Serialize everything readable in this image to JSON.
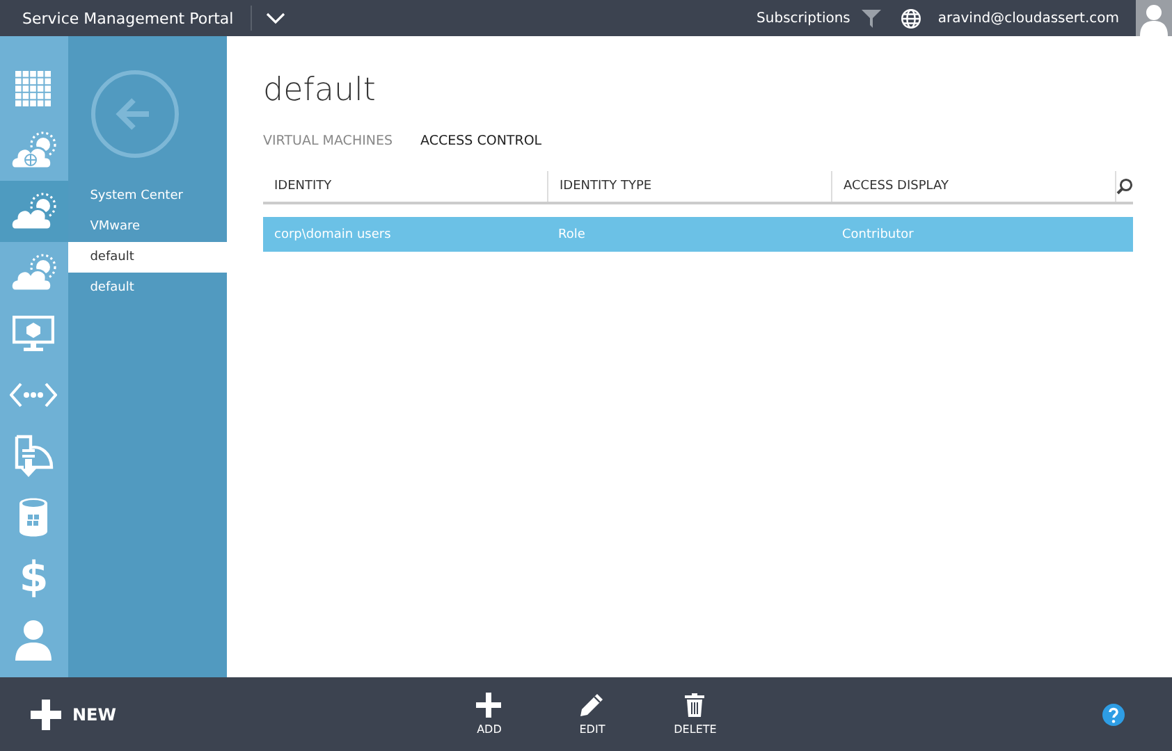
{
  "header": {
    "title": "Service Management Portal",
    "subscriptions": "Subscriptions",
    "user": "aravind@cloudassert.com"
  },
  "rail": [
    {
      "kind": "grid",
      "selected": false
    },
    {
      "kind": "cloud-globe",
      "selected": false
    },
    {
      "kind": "cloud",
      "selected": true
    },
    {
      "kind": "cloud",
      "selected": false
    },
    {
      "kind": "monitor",
      "selected": false
    },
    {
      "kind": "code",
      "selected": false
    },
    {
      "kind": "document",
      "selected": false
    },
    {
      "kind": "database",
      "selected": false
    },
    {
      "kind": "dollar",
      "selected": false,
      "glyph": "$"
    },
    {
      "kind": "person",
      "selected": false
    }
  ],
  "nav": {
    "items": [
      {
        "label": "System Center",
        "selected": false
      },
      {
        "label": "VMware",
        "selected": false
      },
      {
        "label": "default",
        "selected": true
      },
      {
        "label": "default",
        "selected": false
      }
    ]
  },
  "page": {
    "title": "default",
    "tabs": [
      {
        "label": "VIRTUAL MACHINES",
        "selected": false
      },
      {
        "label": "ACCESS CONTROL",
        "selected": true
      }
    ],
    "table": {
      "columns": [
        "IDENTITY",
        "IDENTITY TYPE",
        "ACCESS DISPLAY"
      ],
      "rows": [
        {
          "cells": [
            "corp\\domain users",
            "Role",
            "Contributor"
          ],
          "selected": true
        }
      ]
    }
  },
  "command_bar": {
    "new": "NEW",
    "actions": [
      {
        "kind": "add",
        "label": "ADD"
      },
      {
        "kind": "edit",
        "label": "EDIT"
      },
      {
        "kind": "delete",
        "label": "DELETE"
      }
    ]
  }
}
